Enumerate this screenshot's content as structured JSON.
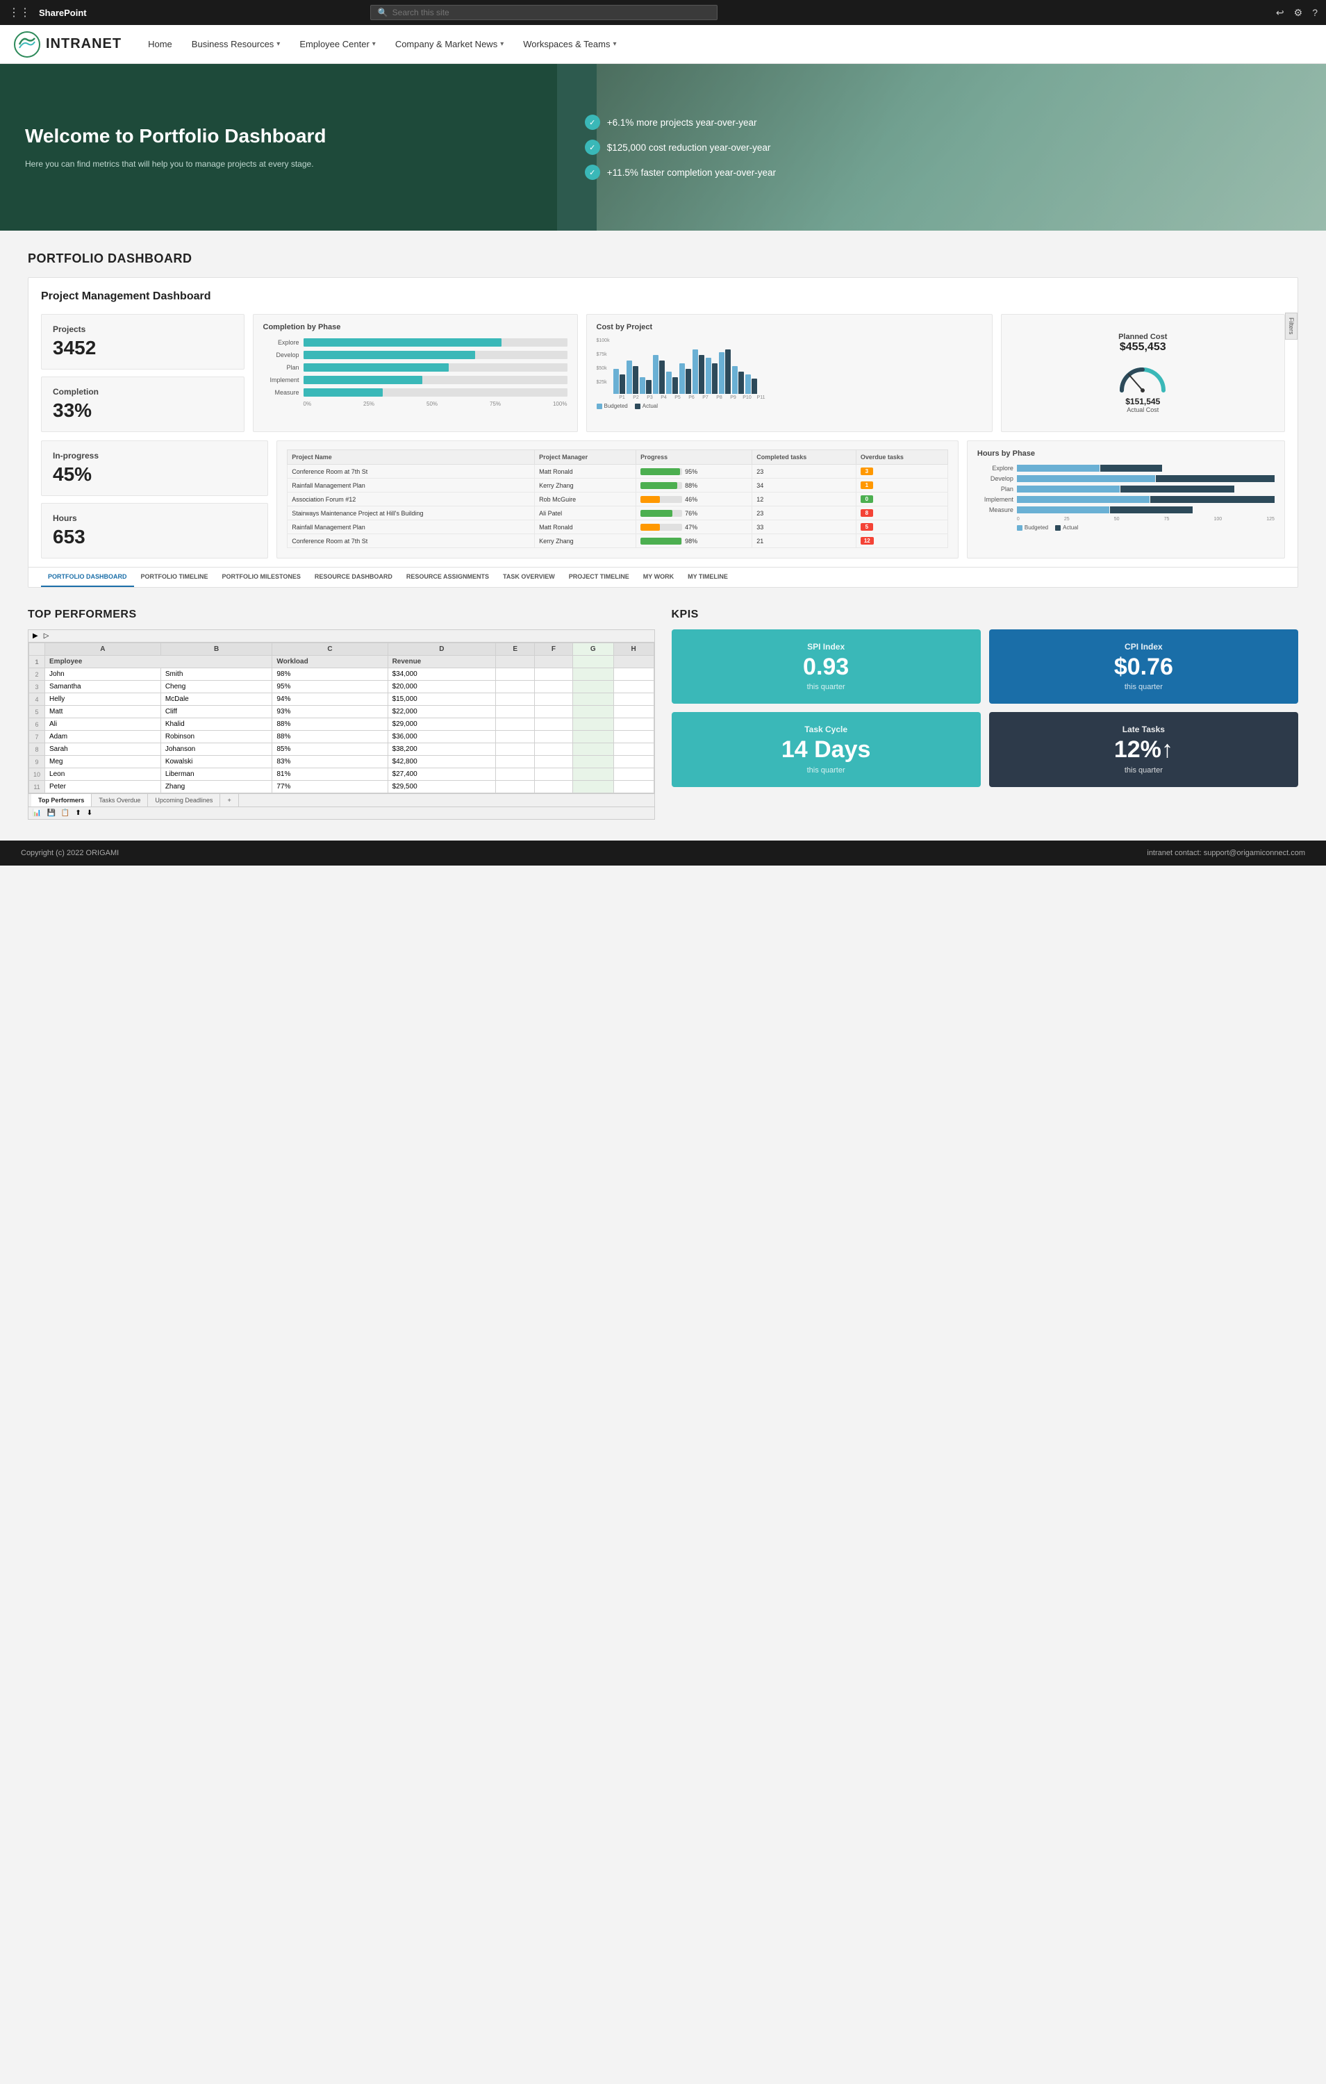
{
  "topbar": {
    "brand": "SharePoint",
    "search_placeholder": "Search this site",
    "icons": [
      "reply-icon",
      "settings-icon",
      "help-icon"
    ]
  },
  "navbar": {
    "logo_text": "INTRANET",
    "home_label": "Home",
    "nav_items": [
      {
        "label": "Business Resources",
        "has_dropdown": true
      },
      {
        "label": "Employee Center",
        "has_dropdown": true
      },
      {
        "label": "Company & Market News",
        "has_dropdown": true
      },
      {
        "label": "Workspaces & Teams",
        "has_dropdown": true
      }
    ]
  },
  "hero": {
    "title": "Welcome to Portfolio Dashboard",
    "subtitle": "Here you can find metrics that will help you to manage projects at every stage.",
    "stats": [
      {
        "text": "+6.1% more projects year-over-year"
      },
      {
        "text": "$125,000 cost reduction year-over-year"
      },
      {
        "text": "+11.5% faster completion year-over-year"
      }
    ]
  },
  "portfolio_section": {
    "title": "PORTFOLIO DASHBOARD",
    "dashboard_title": "Project Management Dashboard",
    "filters_label": "Filters",
    "kpis": [
      {
        "label": "Projects",
        "value": "3452"
      },
      {
        "label": "Completion",
        "value": "33%"
      },
      {
        "label": "In-progress",
        "value": "45%"
      },
      {
        "label": "Hours",
        "value": "653"
      }
    ],
    "completion_by_phase": {
      "title": "Completion by Phase",
      "phases": [
        {
          "label": "Explore",
          "pct": 75
        },
        {
          "label": "Develop",
          "pct": 65
        },
        {
          "label": "Plan",
          "pct": 55
        },
        {
          "label": "Implement",
          "pct": 45
        },
        {
          "label": "Measure",
          "pct": 30
        }
      ],
      "axis": [
        "0%",
        "25%",
        "50%",
        "75%",
        "100%"
      ]
    },
    "cost_by_project": {
      "title": "Cost by Project",
      "legend": [
        "Budgeted",
        "Actual"
      ],
      "projects": [
        "P1",
        "P2",
        "P3",
        "P4",
        "P5",
        "P6",
        "P7",
        "P8",
        "P9",
        "P10",
        "P11"
      ],
      "y_labels": [
        "$100k",
        "$75k",
        "$50k",
        "$25k",
        ""
      ],
      "bars": [
        {
          "budgeted": 45,
          "actual": 35
        },
        {
          "budgeted": 60,
          "actual": 50
        },
        {
          "budgeted": 30,
          "actual": 25
        },
        {
          "budgeted": 70,
          "actual": 60
        },
        {
          "budgeted": 40,
          "actual": 30
        },
        {
          "budgeted": 55,
          "actual": 45
        },
        {
          "budgeted": 80,
          "actual": 70
        },
        {
          "budgeted": 65,
          "actual": 55
        },
        {
          "budgeted": 75,
          "actual": 80
        },
        {
          "budgeted": 50,
          "actual": 40
        },
        {
          "budgeted": 35,
          "actual": 28
        }
      ]
    },
    "planned_cost": {
      "title": "Planned Cost",
      "planned_value": "$455,453",
      "actual_value": "$151,545",
      "actual_label": "Actual Cost"
    },
    "project_table": {
      "headers": [
        "Project Name",
        "Project Manager",
        "Progress",
        "Completed tasks",
        "Overdue tasks"
      ],
      "rows": [
        {
          "name": "Conference Room at 7th St",
          "manager": "Matt Ronald",
          "progress": 95,
          "progress_color": "#4caf50",
          "completed": 23,
          "overdue": 3,
          "overdue_color": "orange"
        },
        {
          "name": "Rainfall Management Plan",
          "manager": "Kerry Zhang",
          "progress": 88,
          "progress_color": "#4caf50",
          "completed": 34,
          "overdue": 1,
          "overdue_color": "red"
        },
        {
          "name": "Association Forum #12",
          "manager": "Rob McGuire",
          "progress": 46,
          "progress_color": "#ff9800",
          "completed": 12,
          "overdue": 0,
          "overdue_color": "green"
        },
        {
          "name": "Stairways Maintenance Project at Hill's Building",
          "manager": "Ali Patel",
          "progress": 76,
          "progress_color": "#4caf50",
          "completed": 23,
          "overdue": 8,
          "overdue_color": "red"
        },
        {
          "name": "Rainfall Management Plan",
          "manager": "Matt Ronald",
          "progress": 47,
          "progress_color": "#ff9800",
          "completed": 33,
          "overdue": 5,
          "overdue_color": "red"
        },
        {
          "name": "Conference Room at 7th St",
          "manager": "Kerry Zhang",
          "progress": 98,
          "progress_color": "#4caf50",
          "completed": 21,
          "overdue": 12,
          "overdue_color": "red"
        }
      ]
    },
    "hours_by_phase": {
      "title": "Hours by Phase",
      "phases": [
        {
          "label": "Explore",
          "budgeted": 40,
          "actual": 30
        },
        {
          "label": "Develop",
          "budgeted": 70,
          "actual": 60
        },
        {
          "label": "Plan",
          "budgeted": 50,
          "actual": 55
        },
        {
          "label": "Implement",
          "budgeted": 80,
          "actual": 75
        },
        {
          "label": "Measure",
          "budgeted": 45,
          "actual": 40
        }
      ],
      "axis": [
        "0",
        "25",
        "50",
        "75",
        "100",
        "125"
      ],
      "legend": [
        "Budgeted",
        "Actual"
      ]
    },
    "tabs": [
      {
        "label": "PORTFOLIO DASHBOARD",
        "active": true
      },
      {
        "label": "PORTFOLIO TIMELINE",
        "active": false
      },
      {
        "label": "PORTFOLIO MILESTONES",
        "active": false
      },
      {
        "label": "RESOURCE DASHBOARD",
        "active": false
      },
      {
        "label": "RESOURCE ASSIGNMENTS",
        "active": false
      },
      {
        "label": "TASK OVERVIEW",
        "active": false
      },
      {
        "label": "PROJECT TIMELINE",
        "active": false
      },
      {
        "label": "MY WORK",
        "active": false
      },
      {
        "label": "MY TIMELINE",
        "active": false
      }
    ]
  },
  "top_performers": {
    "title": "TOP PERFORMERS",
    "col_headers": [
      "A",
      "B",
      "C",
      "D",
      "E",
      "F",
      "G",
      "H"
    ],
    "row_header": [
      "Employee",
      "",
      "Workload",
      "Revenue"
    ],
    "rows": [
      {
        "num": 2,
        "first": "John",
        "last": "Smith",
        "workload": "98%",
        "revenue": "$34,000"
      },
      {
        "num": 3,
        "first": "Samantha",
        "last": "Cheng",
        "workload": "95%",
        "revenue": "$20,000"
      },
      {
        "num": 4,
        "first": "Helly",
        "last": "McDale",
        "workload": "94%",
        "revenue": "$15,000"
      },
      {
        "num": 5,
        "first": "Matt",
        "last": "Cliff",
        "workload": "93%",
        "revenue": "$22,000"
      },
      {
        "num": 6,
        "first": "Ali",
        "last": "Khalid",
        "workload": "88%",
        "revenue": "$29,000"
      },
      {
        "num": 7,
        "first": "Adam",
        "last": "Robinson",
        "workload": "88%",
        "revenue": "$36,000"
      },
      {
        "num": 8,
        "first": "Sarah",
        "last": "Johanson",
        "workload": "85%",
        "revenue": "$38,200"
      },
      {
        "num": 9,
        "first": "Meg",
        "last": "Kowalski",
        "workload": "83%",
        "revenue": "$42,800"
      },
      {
        "num": 10,
        "first": "Leon",
        "last": "Liberman",
        "workload": "81%",
        "revenue": "$27,400"
      },
      {
        "num": 11,
        "first": "Peter",
        "last": "Zhang",
        "workload": "77%",
        "revenue": "$29,500"
      }
    ],
    "tabs": [
      "Top Performers",
      "Tasks Overdue",
      "Upcoming Deadlines"
    ]
  },
  "kpis": {
    "title": "KPIS",
    "cards": [
      {
        "label": "SPI Index",
        "value": "0.93",
        "sub": "this quarter",
        "color": "teal"
      },
      {
        "label": "CPI Index",
        "value": "$0.76",
        "sub": "this quarter",
        "color": "blue"
      },
      {
        "label": "Task Cycle",
        "value": "14 Days",
        "sub": "this quarter",
        "color": "teal"
      },
      {
        "label": "Late Tasks",
        "value": "12%↑",
        "sub": "this quarter",
        "color": "dark"
      }
    ]
  },
  "footer": {
    "copyright": "Copyright (c) 2022 ORIGAMI",
    "contact": "intranet contact: support@origamiconnect.com"
  }
}
